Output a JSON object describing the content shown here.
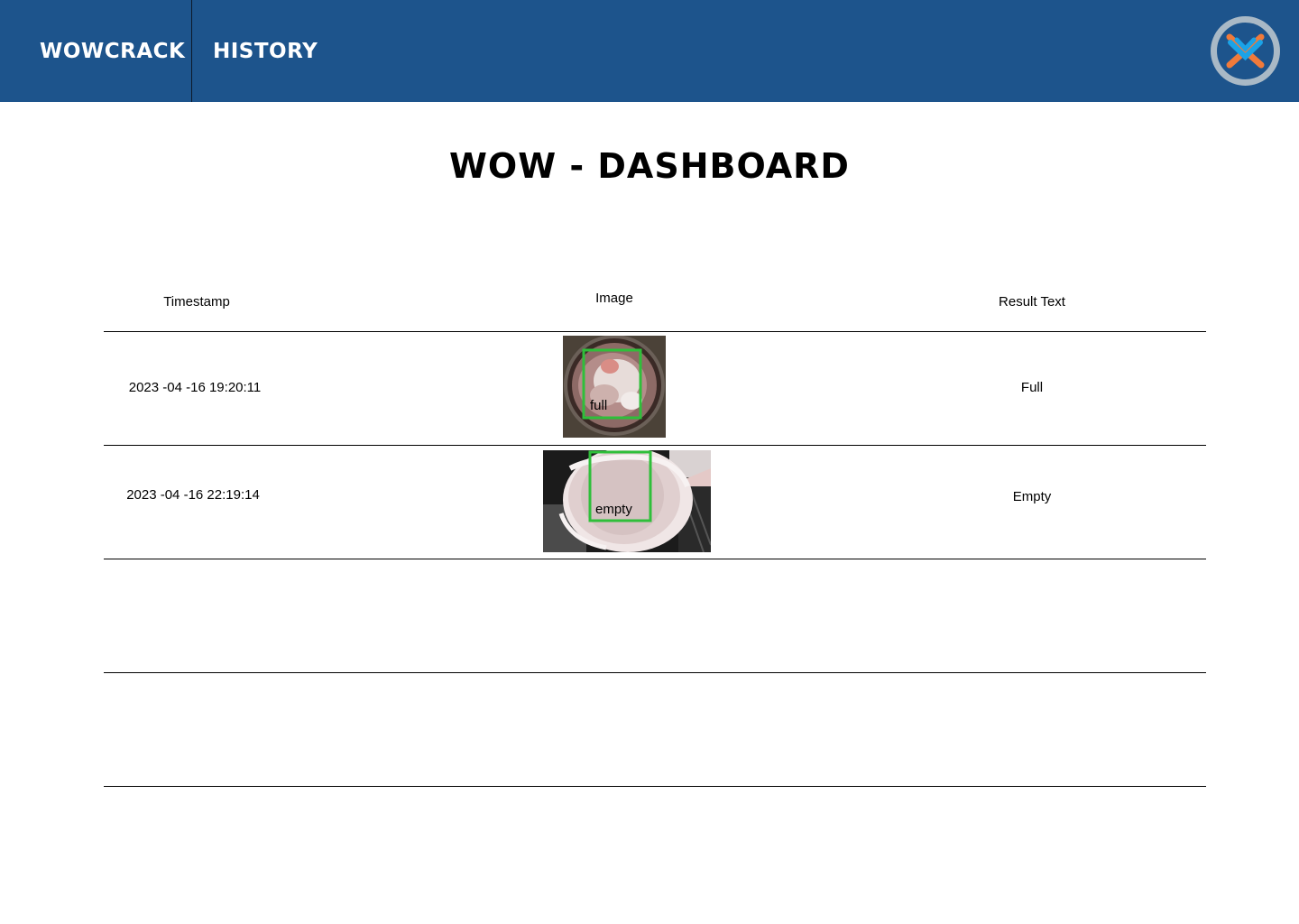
{
  "nav": {
    "brand": "WOWCRACK",
    "history": "HISTORY"
  },
  "page": {
    "title": "WOW - DASHBOARD"
  },
  "table": {
    "headers": {
      "timestamp": "Timestamp",
      "image": "Image",
      "result": "Result Text"
    },
    "rows": [
      {
        "timestamp": "2023 -04 -16 19:20:11",
        "image_label": "full",
        "result": "Full"
      },
      {
        "timestamp": "2023 -04 -16 22:19:14",
        "image_label": "empty",
        "result": "Empty"
      }
    ]
  },
  "colors": {
    "topbar": "#1d548c",
    "detection_box": "#2fbf3a",
    "logo_ring": "#a9b9c6",
    "logo_orange": "#f07a3a",
    "logo_blue": "#1aa3e8"
  },
  "icons": {
    "logo": "crossed-x-logo-icon"
  }
}
